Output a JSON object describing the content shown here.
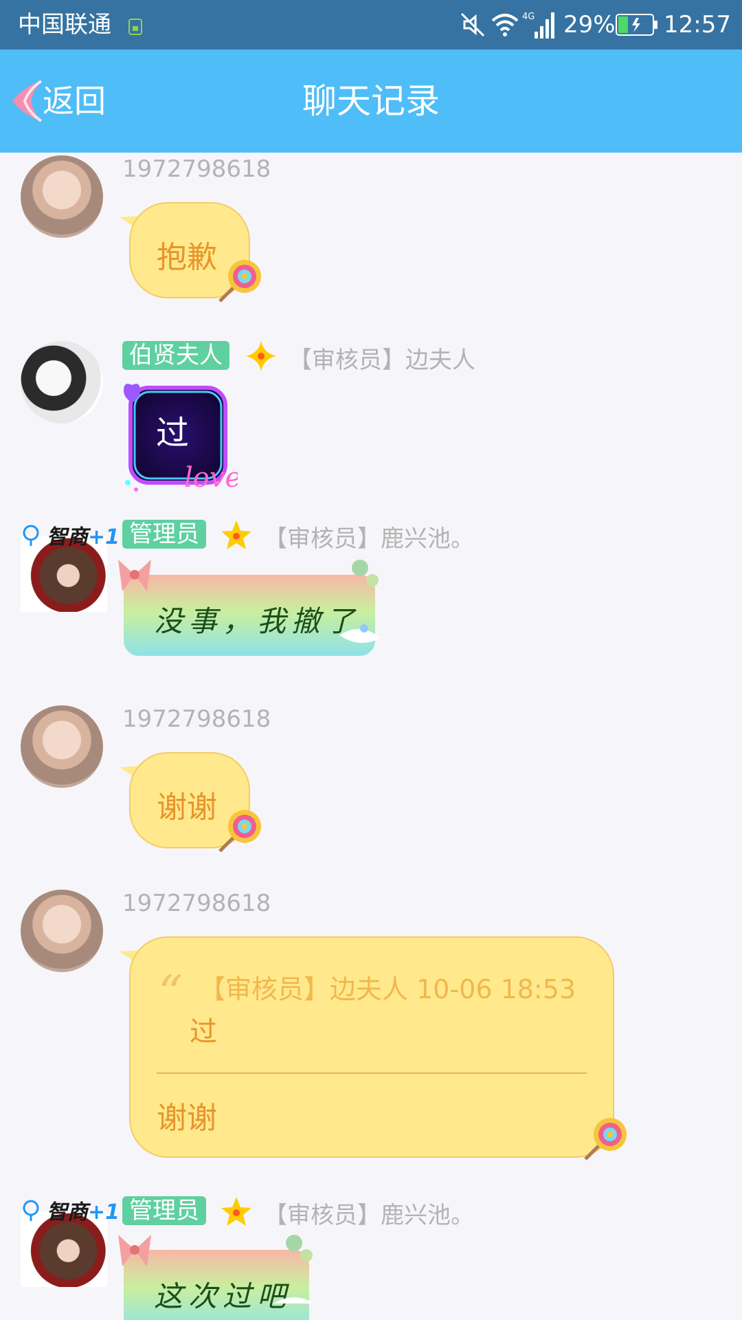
{
  "status_bar": {
    "carrier": "中国联通",
    "battery": "29%",
    "time": "12:57"
  },
  "header": {
    "back_label": "返回",
    "title": "聊天记录"
  },
  "messages": [
    {
      "sender_id": "1972798618",
      "text": "抱歉"
    },
    {
      "tag": "伯贤夫人",
      "nick": "【审核员】边夫人",
      "sticker_text": "过"
    },
    {
      "tag": "管理员",
      "nick": "【审核员】鹿兴池。",
      "text": "没事，我撤了",
      "badge": "智商",
      "badge_plus": "+1"
    },
    {
      "sender_id": "1972798618",
      "text": "谢谢"
    },
    {
      "sender_id": "1972798618",
      "quote_head": "【审核员】边夫人 10-06 18:53",
      "quote_body": "过",
      "reply": "谢谢"
    },
    {
      "tag": "管理员",
      "nick": "【审核员】鹿兴池。",
      "text": "这次过吧",
      "badge": "智商",
      "badge_plus": "+1"
    }
  ],
  "colors": {
    "status_bar": "#3673a2",
    "header": "#4fbdf7",
    "tag_green": "#5fd0a0",
    "bubble_yellow": "#ffe98c",
    "bubble_text": "#e8942b"
  }
}
